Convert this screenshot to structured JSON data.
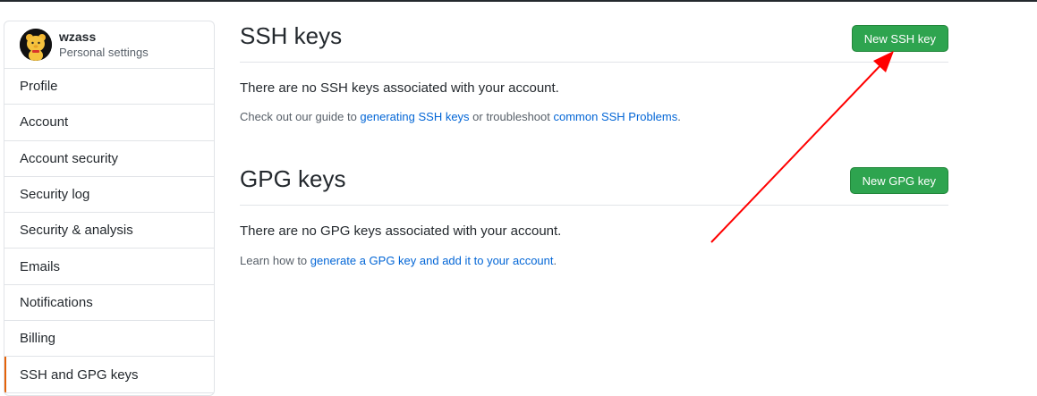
{
  "user": {
    "username": "wzass",
    "subtitle": "Personal settings"
  },
  "sidebar": {
    "items": [
      {
        "label": "Profile"
      },
      {
        "label": "Account"
      },
      {
        "label": "Account security"
      },
      {
        "label": "Security log"
      },
      {
        "label": "Security & analysis"
      },
      {
        "label": "Emails"
      },
      {
        "label": "Notifications"
      },
      {
        "label": "Billing"
      },
      {
        "label": "SSH and GPG keys",
        "selected": true
      }
    ]
  },
  "ssh": {
    "title": "SSH keys",
    "new_button": "New SSH key",
    "empty": "There are no SSH keys associated with your account.",
    "help_prefix": "Check out our guide to ",
    "help_link1": "generating SSH keys",
    "help_middle": " or troubleshoot ",
    "help_link2": "common SSH Problems",
    "help_suffix": "."
  },
  "gpg": {
    "title": "GPG keys",
    "new_button": "New GPG key",
    "empty": "There are no GPG keys associated with your account.",
    "help_prefix": "Learn how to ",
    "help_link": "generate a GPG key and add it to your account",
    "help_suffix": "."
  },
  "colors": {
    "accent_green": "#2ea44f",
    "link_blue": "#0366d6",
    "selected_marker": "#e36209",
    "annotation_arrow": "#ff0000"
  }
}
